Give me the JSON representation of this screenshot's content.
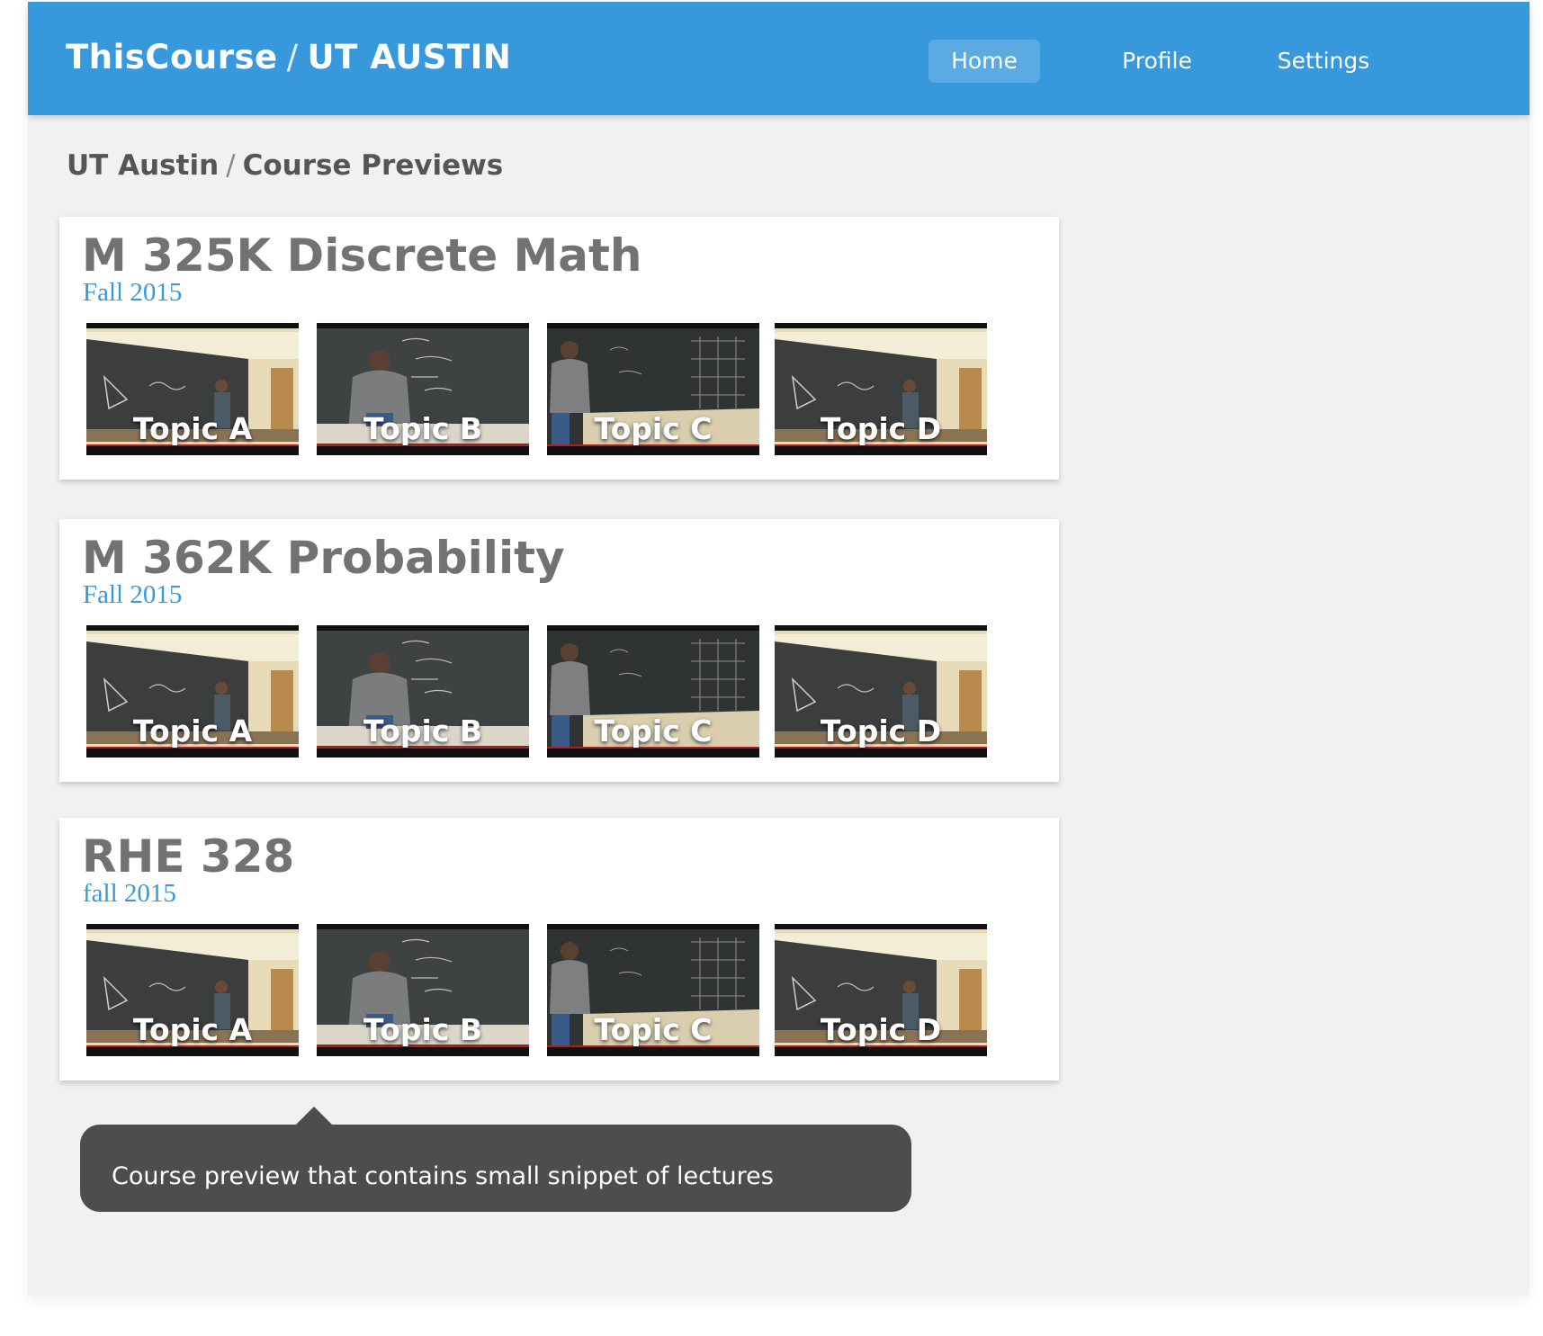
{
  "header": {
    "brand_name": "ThisCourse",
    "brand_separator": "/",
    "school": "UT AUSTIN",
    "nav": [
      {
        "label": "Home",
        "active": true
      },
      {
        "label": "Profile",
        "active": false
      },
      {
        "label": "Settings",
        "active": false
      }
    ]
  },
  "breadcrumb": {
    "school": "UT Austin",
    "separator": "/",
    "page": "Course Previews"
  },
  "courses": [
    {
      "title": "M 325K Discrete Math",
      "term": "Fall 2015",
      "previews": [
        {
          "label": "Topic A",
          "scene": "wide-room"
        },
        {
          "label": "Topic B",
          "scene": "closeup-board"
        },
        {
          "label": "Topic C",
          "scene": "dark-board"
        },
        {
          "label": "Topic D",
          "scene": "wide-room"
        }
      ]
    },
    {
      "title": "M 362K Probability",
      "term": "Fall 2015",
      "previews": [
        {
          "label": "Topic A",
          "scene": "wide-room"
        },
        {
          "label": "Topic B",
          "scene": "closeup-board"
        },
        {
          "label": "Topic C",
          "scene": "dark-board"
        },
        {
          "label": "Topic D",
          "scene": "wide-room"
        }
      ]
    },
    {
      "title": "RHE 328",
      "term": "fall 2015",
      "previews": [
        {
          "label": "Topic A",
          "scene": "wide-room"
        },
        {
          "label": "Topic B",
          "scene": "closeup-board"
        },
        {
          "label": "Topic C",
          "scene": "dark-board"
        },
        {
          "label": "Topic D",
          "scene": "wide-room"
        }
      ]
    }
  ],
  "tooltip": {
    "text": "Course preview that contains small snippet of lectures"
  },
  "colors": {
    "header_blue": "#3898dc",
    "term_blue": "#3898dc",
    "title_gray": "#727272",
    "tooltip_bg": "#4d4d4d",
    "page_bg": "#f1f1f1"
  }
}
